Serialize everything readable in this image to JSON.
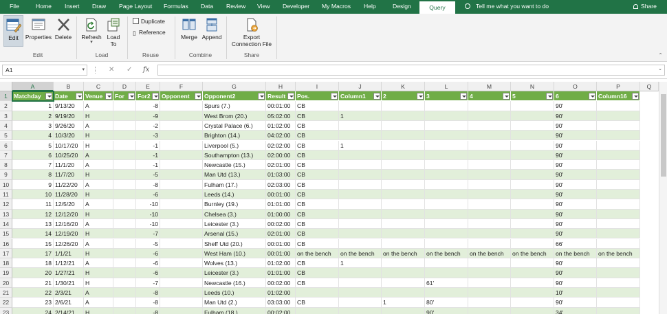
{
  "menu": {
    "tabs": [
      "File",
      "Home",
      "Insert",
      "Draw",
      "Page Layout",
      "Formulas",
      "Data",
      "Review",
      "View",
      "Developer",
      "My Macros",
      "Help",
      "Design",
      "Query"
    ],
    "active": "Query",
    "tell_me": "Tell me what you want to do",
    "share": "Share"
  },
  "ribbon": {
    "edit_group": {
      "label": "Edit",
      "edit": "Edit",
      "properties": "Properties",
      "delete": "Delete"
    },
    "load_group": {
      "label": "Load",
      "refresh": "Refresh",
      "load_to_line1": "Load",
      "load_to_line2": "To"
    },
    "reuse_group": {
      "label": "Reuse",
      "duplicate": "Duplicate",
      "reference": "Reference"
    },
    "combine_group": {
      "label": "Combine",
      "merge": "Merge",
      "append": "Append"
    },
    "share_group": {
      "label": "Share",
      "export_line1": "Export",
      "export_line2": "Connection File"
    }
  },
  "formula_bar": {
    "name_box": "A1",
    "fx": "fx",
    "cancel": "✕",
    "enter": "✓",
    "formula": ""
  },
  "grid": {
    "columns": [
      "A",
      "B",
      "C",
      "D",
      "E",
      "F",
      "G",
      "H",
      "I",
      "J",
      "K",
      "L",
      "M",
      "N",
      "O",
      "P",
      "Q"
    ],
    "row_numbers": [
      "1",
      "2",
      "3",
      "4",
      "5",
      "6",
      "7",
      "8",
      "9",
      "10",
      "11",
      "12",
      "13",
      "14",
      "15",
      "16",
      "17",
      "18",
      "19",
      "20",
      "21",
      "22",
      "23"
    ],
    "headers": [
      "Matchday",
      "Date",
      "Venue",
      "For",
      "For2",
      "Opponent",
      "Opponent2",
      "Result",
      "Pos.",
      "Column1",
      "2",
      "3",
      "4",
      "5",
      "6",
      "Column16"
    ],
    "rows": [
      [
        "1",
        "9/13/20",
        "A",
        "",
        "-8",
        "",
        "Spurs (7.)",
        "00:01:00",
        "CB",
        "",
        "",
        "",
        "",
        "",
        "90'",
        ""
      ],
      [
        "2",
        "9/19/20",
        "H",
        "",
        "-9",
        "",
        "West Brom (20.)",
        "05:02:00",
        "CB",
        "1",
        "",
        "",
        "",
        "",
        "90'",
        ""
      ],
      [
        "3",
        "9/26/20",
        "A",
        "",
        "-2",
        "",
        "Crystal Palace (6.)",
        "01:02:00",
        "CB",
        "",
        "",
        "",
        "",
        "",
        "90'",
        ""
      ],
      [
        "4",
        "10/3/20",
        "H",
        "",
        "-3",
        "",
        "Brighton (14.)",
        "04:02:00",
        "CB",
        "",
        "",
        "",
        "",
        "",
        "90'",
        ""
      ],
      [
        "5",
        "10/17/20",
        "H",
        "",
        "-1",
        "",
        "Liverpool (5.)",
        "02:02:00",
        "CB",
        "1",
        "",
        "",
        "",
        "",
        "90'",
        ""
      ],
      [
        "6",
        "10/25/20",
        "A",
        "",
        "-1",
        "",
        "Southampton (13.)",
        "02:00:00",
        "CB",
        "",
        "",
        "",
        "",
        "",
        "90'",
        ""
      ],
      [
        "7",
        "11/1/20",
        "A",
        "",
        "-1",
        "",
        "Newcastle (15.)",
        "02:01:00",
        "CB",
        "",
        "",
        "",
        "",
        "",
        "90'",
        ""
      ],
      [
        "8",
        "11/7/20",
        "H",
        "",
        "-5",
        "",
        "Man Utd (13.)",
        "01:03:00",
        "CB",
        "",
        "",
        "",
        "",
        "",
        "90'",
        ""
      ],
      [
        "9",
        "11/22/20",
        "A",
        "",
        "-8",
        "",
        "Fulham (17.)",
        "02:03:00",
        "CB",
        "",
        "",
        "",
        "",
        "",
        "90'",
        ""
      ],
      [
        "10",
        "11/28/20",
        "H",
        "",
        "-6",
        "",
        "Leeds (14.)",
        "00:01:00",
        "CB",
        "",
        "",
        "",
        "",
        "",
        "90'",
        ""
      ],
      [
        "11",
        "12/5/20",
        "A",
        "",
        "-10",
        "",
        "Burnley (19.)",
        "01:01:00",
        "CB",
        "",
        "",
        "",
        "",
        "",
        "90'",
        ""
      ],
      [
        "12",
        "12/12/20",
        "H",
        "",
        "-10",
        "",
        "Chelsea (3.)",
        "01:00:00",
        "CB",
        "",
        "",
        "",
        "",
        "",
        "90'",
        ""
      ],
      [
        "13",
        "12/16/20",
        "A",
        "",
        "-10",
        "",
        "Leicester (3.)",
        "00:02:00",
        "CB",
        "",
        "",
        "",
        "",
        "",
        "90'",
        ""
      ],
      [
        "14",
        "12/19/20",
        "H",
        "",
        "-7",
        "",
        "Arsenal (15.)",
        "02:01:00",
        "CB",
        "",
        "",
        "",
        "",
        "",
        "90'",
        ""
      ],
      [
        "15",
        "12/26/20",
        "A",
        "",
        "-5",
        "",
        "Sheff Utd (20.)",
        "00:01:00",
        "CB",
        "",
        "",
        "",
        "",
        "",
        "66'",
        ""
      ],
      [
        "17",
        "1/1/21",
        "H",
        "",
        "-6",
        "",
        "West Ham (10.)",
        "00:01:00",
        "on the bench",
        "on the bench",
        "on the bench",
        "on the bench",
        "on the bench",
        "on the bench",
        "on the bench",
        "on the bench"
      ],
      [
        "18",
        "1/12/21",
        "A",
        "",
        "-6",
        "",
        "Wolves (13.)",
        "01:02:00",
        "CB",
        "1",
        "",
        "",
        "",
        "",
        "90'",
        ""
      ],
      [
        "20",
        "1/27/21",
        "H",
        "",
        "-6",
        "",
        "Leicester (3.)",
        "01:01:00",
        "CB",
        "",
        "",
        "",
        "",
        "",
        "90'",
        ""
      ],
      [
        "21",
        "1/30/21",
        "H",
        "",
        "-7",
        "",
        "Newcastle (16.)",
        "00:02:00",
        "CB",
        "",
        "",
        "61'",
        "",
        "",
        "90'",
        ""
      ],
      [
        "22",
        "2/3/21",
        "A",
        "",
        "-8",
        "",
        "Leeds (10.)",
        "01:02:00",
        "",
        "",
        "",
        "",
        "",
        "",
        "10'",
        ""
      ],
      [
        "23",
        "2/6/21",
        "A",
        "",
        "-8",
        "",
        "Man Utd (2.)",
        "03:03:00",
        "CB",
        "",
        "1",
        "80'",
        "",
        "",
        "90'",
        ""
      ],
      [
        "24",
        "2/14/21",
        "H",
        "",
        "-8",
        "",
        "Fulham (18.)",
        "00:02:00",
        "",
        "",
        "",
        "90'",
        "",
        "",
        "34'",
        ""
      ]
    ]
  }
}
